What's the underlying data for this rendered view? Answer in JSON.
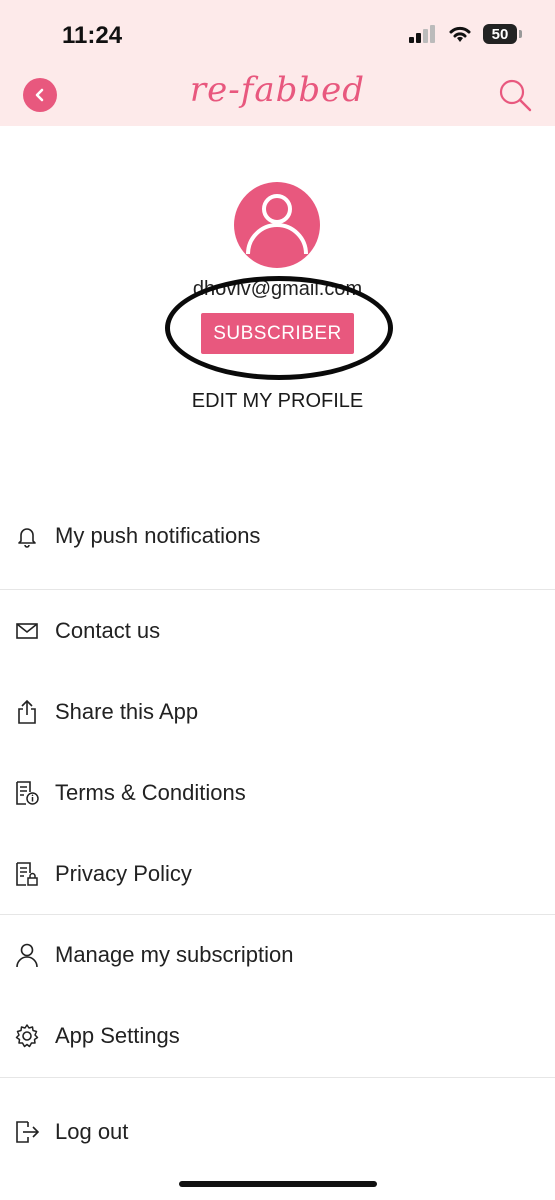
{
  "status_bar": {
    "time": "11:24",
    "battery": "50"
  },
  "header": {
    "logo": "re-fabbed",
    "back_icon": "chevron-left-icon",
    "search_icon": "search-icon"
  },
  "profile": {
    "email": "dhoviv@gmail.com",
    "badge": "SUBSCRIBER",
    "edit_label": "EDIT MY PROFILE"
  },
  "menu": [
    {
      "label": "My push notifications",
      "icon": "bell-icon"
    },
    {
      "label": "Contact us",
      "icon": "envelope-icon"
    },
    {
      "label": "Share this App",
      "icon": "share-icon"
    },
    {
      "label": "Terms & Conditions",
      "icon": "document-info-icon"
    },
    {
      "label": "Privacy Policy",
      "icon": "document-lock-icon"
    },
    {
      "label": "Manage my subscription",
      "icon": "user-icon"
    },
    {
      "label": "App Settings",
      "icon": "gear-icon"
    },
    {
      "label": "Log out",
      "icon": "logout-icon"
    }
  ],
  "colors": {
    "accent": "#e8587e",
    "header_bg": "#fdeaea"
  }
}
